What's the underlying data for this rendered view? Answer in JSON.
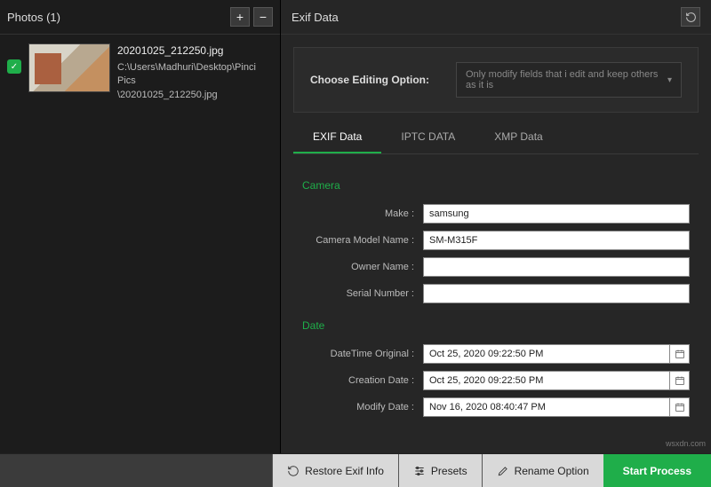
{
  "left": {
    "title": "Photos (1)",
    "add_tooltip": "+",
    "remove_tooltip": "−",
    "item": {
      "filename": "20201025_212250.jpg",
      "path_line1": "C:\\Users\\Madhuri\\Desktop\\Pinci Pics",
      "path_line2": "\\20201025_212250.jpg"
    }
  },
  "right": {
    "title": "Exif Data",
    "choose_label": "Choose Editing Option:",
    "choose_value": "Only modify fields that i edit and keep others as it is",
    "tabs": {
      "exif": "EXIF Data",
      "iptc": "IPTC DATA",
      "xmp": "XMP Data"
    },
    "sections": {
      "camera": {
        "title": "Camera",
        "make_label": "Make :",
        "make_value": "samsung",
        "model_label": "Camera Model Name :",
        "model_value": "SM-M315F",
        "owner_label": "Owner Name :",
        "owner_value": "",
        "serial_label": "Serial Number :",
        "serial_value": ""
      },
      "date": {
        "title": "Date",
        "dt_orig_label": "DateTime Original :",
        "dt_orig_value": "Oct 25, 2020 09:22:50 PM",
        "creation_label": "Creation Date :",
        "creation_value": "Oct 25, 2020 09:22:50 PM",
        "modify_label": "Modify Date :",
        "modify_value": "Nov 16, 2020 08:40:47 PM"
      }
    }
  },
  "footer": {
    "restore": "Restore Exif Info",
    "presets": "Presets",
    "rename": "Rename Option",
    "start": "Start Process"
  },
  "watermark": "wsxdn.com"
}
